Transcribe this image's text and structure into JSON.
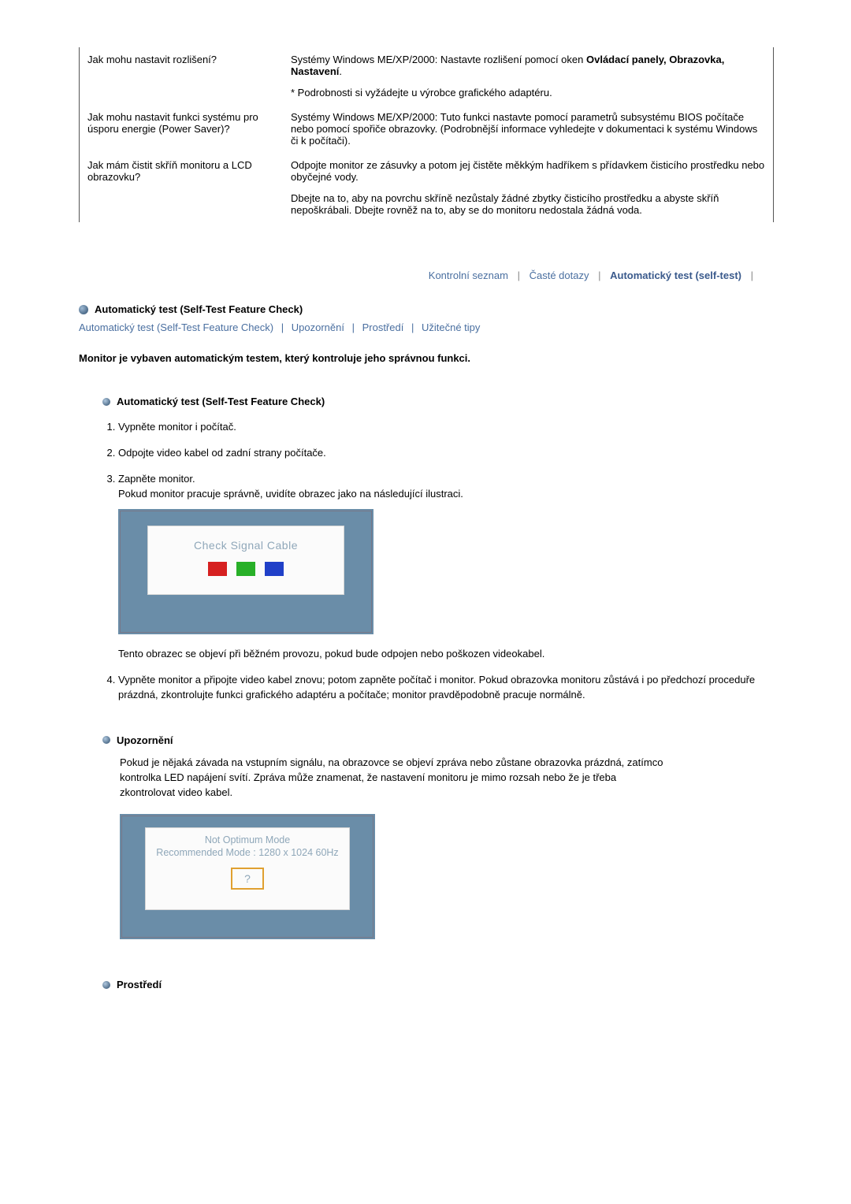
{
  "faq": [
    {
      "q": "Jak mohu nastavit rozlišení?",
      "a_line1_prefix": "Systémy Windows ME/XP/2000: Nastavte rozlišení pomocí oken ",
      "a_line1_bold": "Ovládací panely, Obrazovka, Nastavení",
      "a_line1_suffix": ".",
      "a_line2": "* Podrobnosti si vyžádejte u výrobce grafického adaptéru."
    },
    {
      "q": "Jak mohu nastavit funkci systému pro úsporu energie (Power Saver)?",
      "a": "Systémy Windows ME/XP/2000: Tuto funkci nastavte pomocí parametrů subsystému BIOS počítače nebo pomocí spořiče obrazovky. (Podrobnější informace vyhledejte v dokumentaci k systému Windows či k počítači)."
    },
    {
      "q": "Jak mám čistit skříň monitoru a LCD obrazovku?",
      "a1": "Odpojte monitor ze zásuvky a potom jej čistěte měkkým hadříkem s přídavkem čisticího prostředku nebo obyčejné vody.",
      "a2": "Dbejte na to, aby na povrchu skříně nezůstaly žádné zbytky čisticího prostředku a abyste skříň nepoškrábali. Dbejte rovněž na to, aby se do monitoru nedostala žádná voda."
    }
  ],
  "tabs": {
    "t1": "Kontrolní seznam",
    "t2": "Časté dotazy",
    "t3": "Automatický test (self-test)"
  },
  "section_title": "Automatický test (Self-Test Feature Check)",
  "sublinks": {
    "l1": "Automatický test (Self-Test Feature Check)",
    "l2": "Upozornění",
    "l3": "Prostředí",
    "l4": "Užitečné tipy"
  },
  "intro": "Monitor je vybaven automatickým testem, který kontroluje jeho správnou funkci.",
  "selftest": {
    "heading": "Automatický test (Self-Test Feature Check)",
    "step1": "Vypněte monitor i počítač.",
    "step2": "Odpojte video kabel od zadní strany počítače.",
    "step3a": "Zapněte monitor.",
    "step3b": "Pokud monitor pracuje správně, uvidíte obrazec jako na následující ilustraci.",
    "monitor_msg": "Check Signal Cable",
    "after_img": "Tento obrazec se objeví při běžném provozu, pokud bude odpojen nebo poškozen videokabel.",
    "step4": "Vypněte monitor a připojte video kabel znovu; potom zapněte počítač i monitor. Pokud obrazovka monitoru zůstává i po předchozí proceduře prázdná, zkontrolujte funkci grafického adaptéru a počítače; monitor pravděpodobně pracuje normálně."
  },
  "warning": {
    "heading": "Upozornění",
    "body": "Pokud je nějaká závada na vstupním signálu, na obrazovce se objeví zpráva nebo zůstane obrazovka prázdná, zatímco kontrolka LED napájení svítí. Zpráva může znamenat, že nastavení monitoru je mimo rozsah nebo že je třeba zkontrolovat video kabel.",
    "msg1": "Not Optimum Mode",
    "msg2": "Recommended Mode : 1280 x 1024  60Hz",
    "qmark": "?"
  },
  "env": {
    "heading": "Prostředí"
  }
}
